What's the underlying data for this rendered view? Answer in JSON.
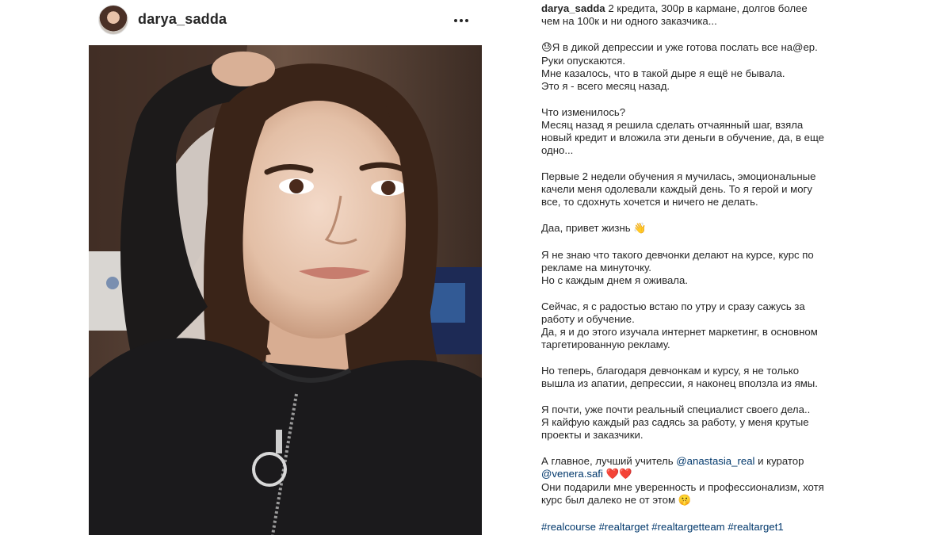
{
  "post": {
    "username": "darya_sadda",
    "more_label": "•••"
  },
  "caption": {
    "username": "darya_sadda",
    "p1": "2 кредита, 300р в кармане, долгов более чем на 100к и  ни одного заказчика...",
    "p2_emoji": "😓",
    "p2_l1": "Я в дикой депрессии и уже готова послать все на@ер. Руки опускаются.",
    "p2_l2": "Мне казалось, что в такой дыре я ещё не бывала.",
    "p2_l3": "Это я - всего месяц назад.",
    "p3_l1": "Что изменилось?",
    "p3_l2": "Месяц назад я решила сделать отчаянный шаг, взяла новый кредит и вложила эти деньги в обучение, да, в еще одно...",
    "p4": "Первые 2 недели обучения я мучилась, эмоциональные качели меня одолевали каждый день. То я герой и могу все, то сдохнуть хочется и ничего не делать.",
    "p5_text": "Даа, привет жизнь",
    "p5_emoji": "👋",
    "p6_l1": "Я не знаю что такого девчонки делают на курсе, курс по рекламе на минуточку.",
    "p6_l2": "Но с каждым днем я оживала.",
    "p7_l1": "Сейчас, я с радостью встаю по утру и сразу сажусь за работу и обучение.",
    "p7_l2": "Да, я и до этого изучала интернет маркетинг, в основном таргетированную рекламу.",
    "p8": "Но теперь, благодаря девчонкам и курсу, я не только вышла из апатии, депрессии, я наконец вползла из ямы.",
    "p9_l1": "Я почти, уже почти реальный специалист своего дела..",
    "p9_l2": "Я кайфую каждый раз садясь за работу, у меня крутые проекты и заказчики.",
    "p10_a": "А главное, лучший учитель",
    "mention1": "@anastasia_real",
    "p10_b": "и куратор",
    "mention2": "@venera.safi",
    "hearts": "❤️❤️",
    "p10_c": "Они подарили мне уверенность и профессионализм, хотя курс был далеко не от этом",
    "p10_emoji": "🤫",
    "hashtags": [
      "#realcourse",
      "#realtarget",
      "#realtargetteam",
      "#realtarget1"
    ]
  },
  "colors": {
    "text": "#262626",
    "link": "#00376b",
    "background": "#ffffff"
  }
}
